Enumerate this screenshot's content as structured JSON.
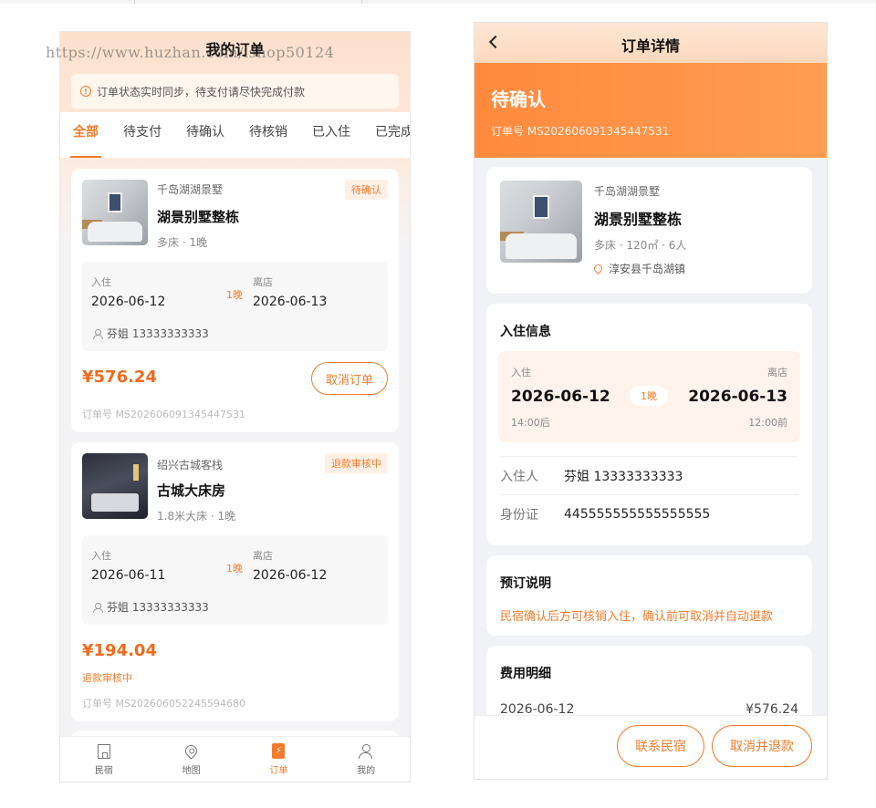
{
  "watermark": "https://www.huzhan.com/ishop50124",
  "list_page": {
    "title": "我的订单",
    "notice": "订单状态实时同步，待支付请尽快完成付款",
    "notice_icon": "info-icon",
    "tabs": [
      "全部",
      "待支付",
      "待确认",
      "待核销",
      "已入住",
      "已完成"
    ],
    "active_tab": "全部",
    "orders": [
      {
        "hotel": "千岛湖湖景墅",
        "room": "湖景别墅整栋",
        "spec": "多床 · 1晚",
        "status": "待确认",
        "checkin_label": "入住",
        "checkin": "2026-06-12",
        "nights": "1晚",
        "checkout_label": "离店",
        "checkout": "2026-06-13",
        "guest": "芬姐 13333333333",
        "price": "¥576.24",
        "action": "取消订单",
        "order_no": "订单号 MS202606091345447531"
      },
      {
        "hotel": "绍兴古城客栈",
        "room": "古城大床房",
        "spec": "1.8米大床 · 1晚",
        "status": "退款审核中",
        "checkin_label": "入住",
        "checkin": "2026-06-11",
        "nights": "1晚",
        "checkout_label": "离店",
        "checkout": "2026-06-12",
        "guest": "芬姐 13333333333",
        "price": "¥194.04",
        "refund_note": "退款审核中",
        "order_no": "订单号 MS202606052245594680"
      }
    ],
    "bottom_nav": [
      {
        "label": "民宿",
        "icon": "homestay-icon"
      },
      {
        "label": "地图",
        "icon": "map-pin-icon"
      },
      {
        "label": "订单",
        "icon": "order-icon",
        "active": true
      },
      {
        "label": "我的",
        "icon": "user-icon"
      }
    ]
  },
  "detail_page": {
    "title": "订单详情",
    "status": "待确认",
    "order_no": "订单号 MS202606091345447531",
    "hotel": "千岛湖湖景墅",
    "room": "湖景别墅整栋",
    "spec": "多床 · 120㎡ · 6人",
    "address": "淳安县千岛湖镇",
    "stay": {
      "title": "入住信息",
      "checkin_label": "入住",
      "checkout_label": "离店",
      "checkin": "2026-06-12",
      "checkout": "2026-06-13",
      "nights": "1晚",
      "checkin_time": "14:00后",
      "checkout_time": "12:00前",
      "guest_label": "入住人",
      "guest": "芬姐 13333333333",
      "id_label": "身份证",
      "id": "445555555555555555"
    },
    "booking_note": {
      "title": "预订说明",
      "text": "民宿确认后方可核销入住，确认前可取消并自动退款"
    },
    "fees": {
      "title": "费用明细",
      "date": "2026-06-12",
      "amount": "¥576.24"
    },
    "buttons": {
      "contact": "联系民宿",
      "cancel": "取消并退款"
    }
  },
  "colors": {
    "accent": "#f37b2b",
    "price": "#f06a1d"
  }
}
